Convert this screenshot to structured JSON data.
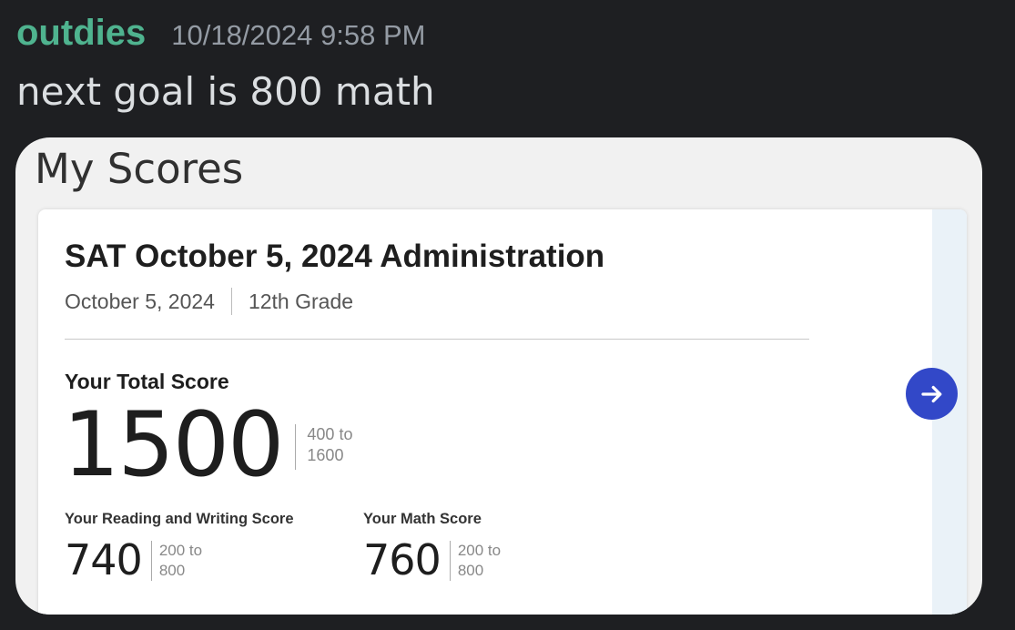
{
  "message": {
    "username": "outdies",
    "timestamp": "10/18/2024 9:58 PM",
    "text": "next goal is 800 math"
  },
  "attachment": {
    "title": "My Scores",
    "card": {
      "title": "SAT October 5, 2024 Administration",
      "date": "October 5, 2024",
      "grade": "12th Grade",
      "total_label": "Your Total Score",
      "total_score": "1500",
      "total_range_top": "400 to",
      "total_range_bottom": "1600",
      "rw_label": "Your Reading and Writing Score",
      "rw_score": "740",
      "rw_range_top": "200 to",
      "rw_range_bottom": "800",
      "math_label": "Your Math Score",
      "math_score": "760",
      "math_range_top": "200 to",
      "math_range_bottom": "800",
      "arrow_icon": "arrow-right-icon"
    }
  },
  "colors": {
    "background": "#1e1f22",
    "username": "#4fb38f",
    "timestamp": "#949ba4",
    "message_text": "#dbdee1",
    "arrow_button": "#3248c8"
  }
}
